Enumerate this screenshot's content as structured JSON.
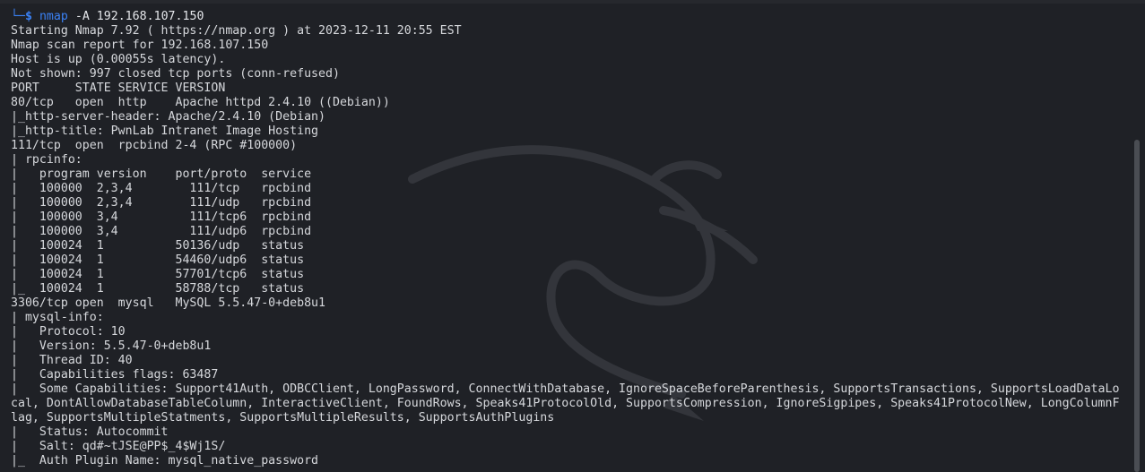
{
  "prompt": {
    "corner": "└─",
    "dollar": "$",
    "command": "nmap",
    "args": " -A 192.168.107.150"
  },
  "output_lines": [
    "Starting Nmap 7.92 ( https://nmap.org ) at 2023-12-11 20:55 EST",
    "Nmap scan report for 192.168.107.150",
    "Host is up (0.00055s latency).",
    "Not shown: 997 closed tcp ports (conn-refused)",
    "PORT     STATE SERVICE VERSION",
    "80/tcp   open  http    Apache httpd 2.4.10 ((Debian))",
    "|_http-server-header: Apache/2.4.10 (Debian)",
    "|_http-title: PwnLab Intranet Image Hosting",
    "111/tcp  open  rpcbind 2-4 (RPC #100000)",
    "| rpcinfo:",
    "|   program version    port/proto  service",
    "|   100000  2,3,4        111/tcp   rpcbind",
    "|   100000  2,3,4        111/udp   rpcbind",
    "|   100000  3,4          111/tcp6  rpcbind",
    "|   100000  3,4          111/udp6  rpcbind",
    "|   100024  1          50136/udp   status",
    "|   100024  1          54460/udp6  status",
    "|   100024  1          57701/tcp6  status",
    "|_  100024  1          58788/tcp   status",
    "3306/tcp open  mysql   MySQL 5.5.47-0+deb8u1",
    "| mysql-info:",
    "|   Protocol: 10",
    "|   Version: 5.5.47-0+deb8u1",
    "|   Thread ID: 40",
    "|   Capabilities flags: 63487",
    "|   Some Capabilities: Support41Auth, ODBCClient, LongPassword, ConnectWithDatabase, IgnoreSpaceBeforeParenthesis, SupportsTransactions, SupportsLoadDataLo",
    "cal, DontAllowDatabaseTableColumn, InteractiveClient, FoundRows, Speaks41ProtocolOld, SupportsCompression, IgnoreSigpipes, Speaks41ProtocolNew, LongColumnF",
    "lag, SupportsMultipleStatments, SupportsMultipleResults, SupportsAuthPlugins",
    "|   Status: Autocommit",
    "|   Salt: qd#~tJSE@PP$_4$Wj1S/",
    "|_  Auth Plugin Name: mysql_native_password"
  ],
  "colors": {
    "background": "#1f2126",
    "text": "#d6d8dc",
    "prompt_accent": "#3b82f6"
  },
  "icons": {
    "background_logo": "kali-dragon-icon"
  }
}
